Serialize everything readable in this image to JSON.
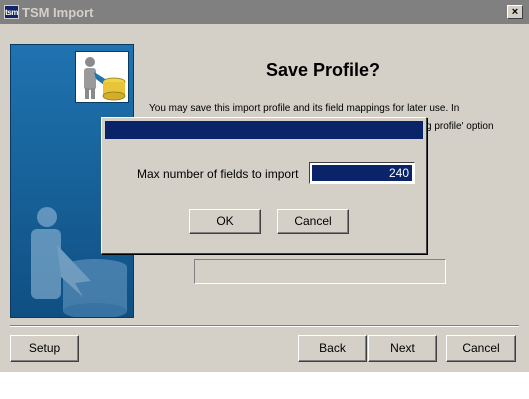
{
  "window": {
    "title": "TSM Import",
    "app_icon_text": "tsm",
    "close_label": "×"
  },
  "page": {
    "heading": "Save Profile?",
    "description_line1": "You may save this import profile and its field mappings for later use. In",
    "description_line2_fragment": "g profile' option"
  },
  "dialog": {
    "field_label": "Max number of fields to import",
    "field_value": "240",
    "ok_label": "OK",
    "cancel_label": "Cancel"
  },
  "footer": {
    "setup_label": "Setup",
    "back_label": "Back",
    "next_label": "Next",
    "cancel_label": "Cancel"
  },
  "colors": {
    "panel_blue": "#1d6aa3",
    "selection_navy": "#0a246a",
    "face": "#d4d0c8"
  }
}
